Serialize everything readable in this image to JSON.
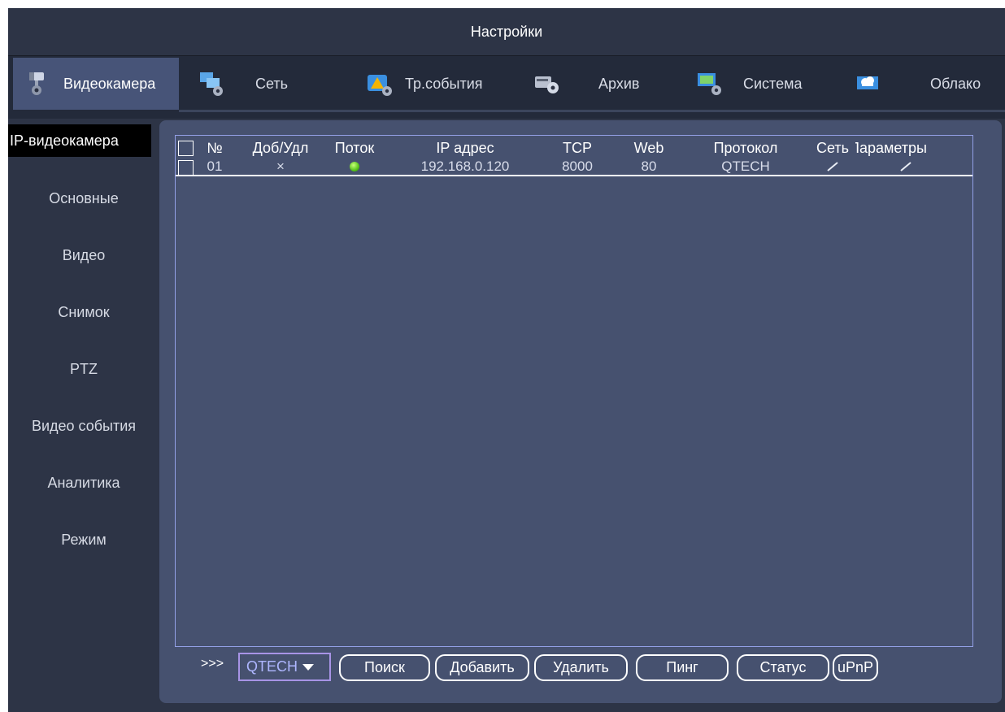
{
  "window": {
    "title": "Настройки"
  },
  "tabs": [
    {
      "label": "Видеокамера",
      "icon": "camera-icon",
      "active": true
    },
    {
      "label": "Сеть",
      "icon": "network-icon"
    },
    {
      "label": "Тр.события",
      "icon": "alarm-events-icon"
    },
    {
      "label": "Архив",
      "icon": "storage-icon"
    },
    {
      "label": "Система",
      "icon": "system-icon"
    },
    {
      "label": "Облако",
      "icon": "cloud-icon"
    }
  ],
  "sidebar": {
    "items": [
      {
        "label": "IP-видеокамера",
        "active": true
      },
      {
        "label": "Основные"
      },
      {
        "label": "Видео"
      },
      {
        "label": "Снимок"
      },
      {
        "label": "PTZ"
      },
      {
        "label": "Видео события"
      },
      {
        "label": "Аналитика"
      },
      {
        "label": "Режим"
      }
    ]
  },
  "table": {
    "columns": [
      "№",
      "Доб/Удл",
      "Поток",
      "IP адрес",
      "TCP",
      "Web",
      "Протокол",
      "Сеть",
      "Параметры"
    ],
    "rows": [
      {
        "number": "01",
        "add_remove": "×",
        "stream_status": "online",
        "ip": "192.168.0.120",
        "tcp": "8000",
        "web": "80",
        "protocol": "QTECH",
        "network_edit": "✎",
        "params_edit": "✎"
      }
    ]
  },
  "toolbar": {
    "arrows": ">>>",
    "protocol_select": "QTECH",
    "buttons": {
      "search": "Поиск",
      "add": "Добавить",
      "delete": "Удалить",
      "ping": "Пинг",
      "status": "Статус",
      "upnp": "uPnP"
    }
  },
  "colors": {
    "background": "#2d3446",
    "tab_bar": "#232a3a",
    "active_tab": "#475478",
    "panel": "#46516f",
    "table_border": "#93a0e6",
    "stream_online": "#58c41a"
  }
}
